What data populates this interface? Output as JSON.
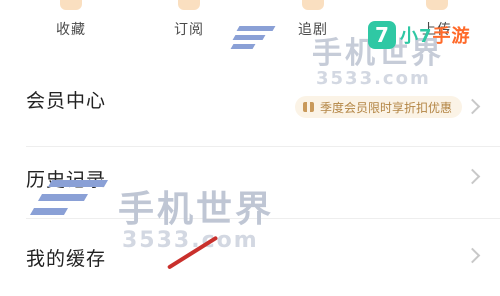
{
  "shortcuts": [
    {
      "label": "收藏",
      "icon": "star-icon"
    },
    {
      "label": "订阅",
      "icon": "subscribe-icon"
    },
    {
      "label": "追剧",
      "icon": "tv-icon"
    },
    {
      "label": "上传",
      "icon": "upload-icon"
    }
  ],
  "menu": {
    "vip": {
      "label": "会员中心",
      "promo": "季度会员限时享折扣优惠"
    },
    "history": {
      "label": "历史记录"
    },
    "cache": {
      "label": "我的缓存"
    }
  },
  "watermarks": {
    "site_name": "手机世界",
    "site_url": "3533.com",
    "brand_badge": "7",
    "brand_name": "小7",
    "brand_name_suffix": "手游"
  },
  "colors": {
    "accent_gold": "#b38544",
    "brand_green": "#2fc8a4",
    "brand_orange": "#ff6a2a"
  }
}
